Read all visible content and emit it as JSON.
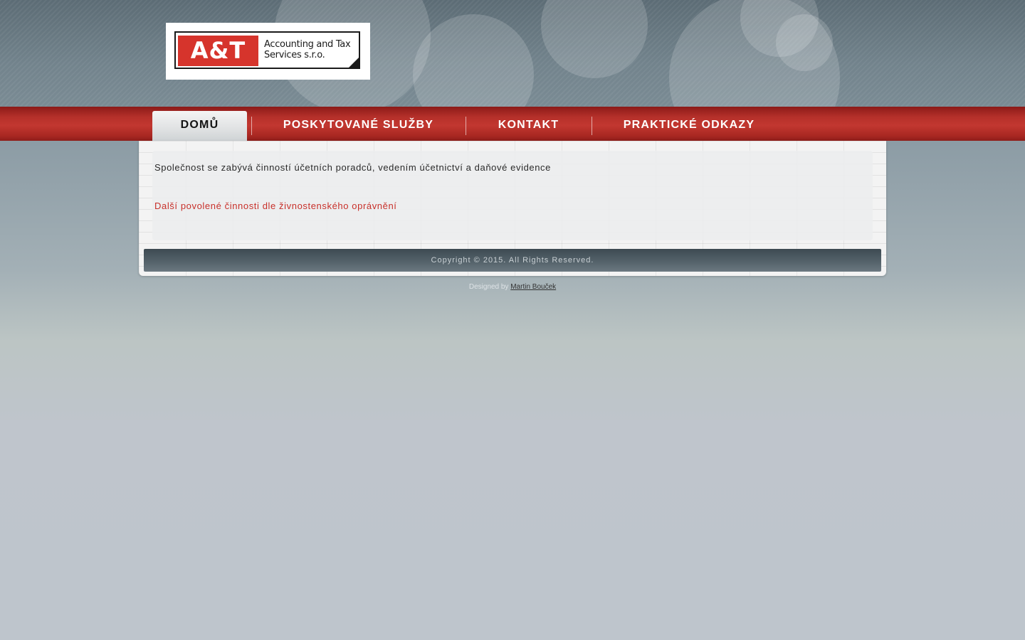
{
  "logo": {
    "mark": "A&T",
    "text_line1": "Accounting and Tax",
    "text_line2": "Services s.r.o."
  },
  "nav": {
    "items": [
      {
        "label": "DOMŮ",
        "active": true
      },
      {
        "label": "POSKYTOVANÉ SLUŽBY",
        "active": false
      },
      {
        "label": "KONTAKT",
        "active": false
      },
      {
        "label": "PRAKTICKÉ ODKAZY",
        "active": false
      }
    ]
  },
  "content": {
    "intro": "Společnost se zabývá činností účetních poradců, vedením účetnictví a daňové evidence",
    "link": "Další povolené činnosti dle živnostenského oprávnění"
  },
  "footer": {
    "copyright": "Copyright © 2015. All Rights Reserved."
  },
  "credits": {
    "prefix": "Designed by",
    "author": "Martin Bouček"
  },
  "colors": {
    "nav_red": "#b5302a",
    "link_red": "#c8302a",
    "logo_red": "#d6342c"
  }
}
